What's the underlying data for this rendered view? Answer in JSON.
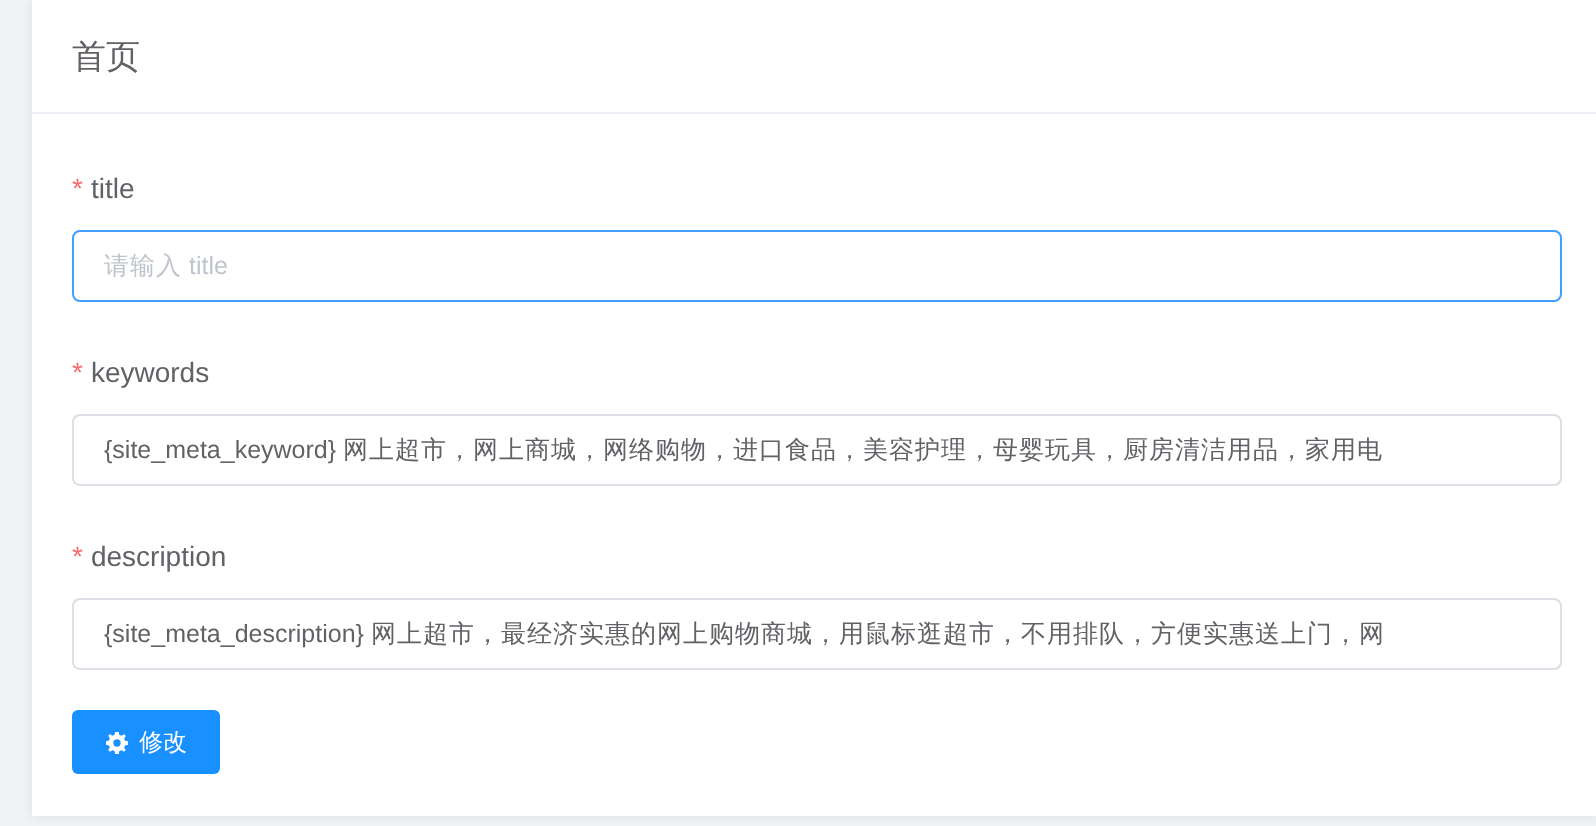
{
  "page_title": "首页",
  "fields": [
    {
      "label": "title",
      "required_mark": "*",
      "placeholder": "请输入 title",
      "focused": true
    },
    {
      "label": "keywords",
      "required_mark": "*",
      "value": "{site_meta_keyword} 网上超市，网上商城，网络购物，进口食品，美容护理，母婴玩具，厨房清洁用品，家用电",
      "focused": false
    },
    {
      "label": "description",
      "required_mark": "*",
      "value": "{site_meta_description} 网上超市，最经济实惠的网上购物商城，用鼠标逛超市，不用排队，方便实惠送上门，网",
      "focused": false
    }
  ],
  "submit_button": {
    "label": "修改"
  }
}
